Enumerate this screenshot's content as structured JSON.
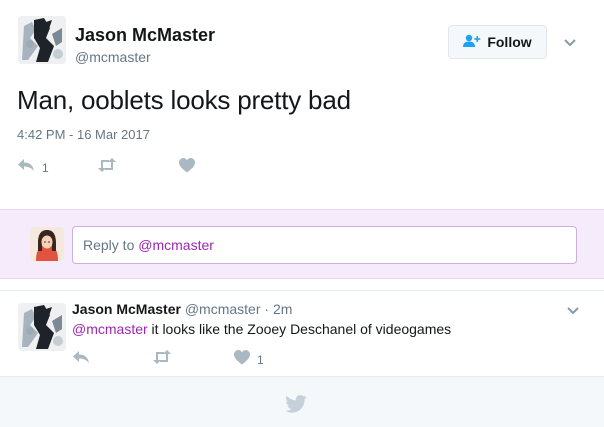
{
  "tweet": {
    "author_name": "Jason McMaster",
    "author_handle": "@mcmaster",
    "follow_label": "Follow",
    "text": "Man, ooblets looks pretty bad",
    "timestamp": "4:42 PM - 16 Mar 2017",
    "reply_count": "1",
    "retweet_count": "",
    "like_count": ""
  },
  "reply_box": {
    "placeholder_prefix": "Reply to ",
    "placeholder_mention": "@mcmaster"
  },
  "reply": {
    "author_name": "Jason McMaster",
    "author_handle": "@mcmaster",
    "separator": " · ",
    "time": "2m",
    "mention": "@mcmaster",
    "text": " it looks like the Zooey Deschanel of videogames",
    "reply_count": "",
    "retweet_count": "",
    "like_count": "1"
  },
  "icons": {
    "reply": "reply-icon",
    "retweet": "retweet-icon",
    "like": "heart-icon",
    "caret": "chevron-down-icon",
    "follow": "add-user-icon",
    "footer": "twitter-bird-icon"
  },
  "colors": {
    "accent": "#9c27b0",
    "link_blue": "#1da1f2",
    "muted": "#657786",
    "reply_bg": "#f5ebfa",
    "footer_bg": "#f5f8fa"
  }
}
